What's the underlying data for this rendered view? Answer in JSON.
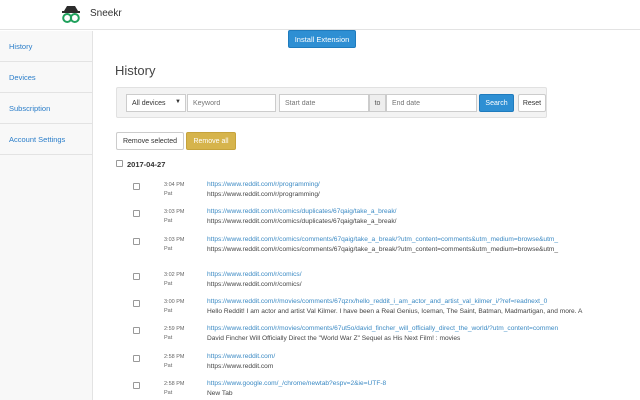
{
  "app": {
    "brand": "Sneekr"
  },
  "header": {
    "install_label": "Install Extension"
  },
  "sidebar": {
    "items": [
      {
        "label": "History"
      },
      {
        "label": "Devices"
      },
      {
        "label": "Subscription"
      },
      {
        "label": "Account Settings"
      }
    ]
  },
  "main": {
    "title": "History",
    "filters": {
      "device_selected": "All devices",
      "keyword_placeholder": "Keyword",
      "start_placeholder": "Start date",
      "to_label": "to",
      "end_placeholder": "End date",
      "search_label": "Search",
      "reset_label": "Reset"
    },
    "actions": {
      "remove_selected_label": "Remove selected",
      "remove_all_label": "Remove all"
    },
    "date_group": "2017-04-27",
    "entries": [
      {
        "time": "3:04 PM",
        "device": "Pat",
        "url": "https://www.reddit.com/r/programming/",
        "title": "https://www.reddit.com/r/programming/"
      },
      {
        "time": "3:03 PM",
        "device": "Pat",
        "url": "https://www.reddit.com/r/comics/duplicates/67qaig/take_a_break/",
        "title": "https://www.reddit.com/r/comics/duplicates/67qaig/take_a_break/"
      },
      {
        "time": "3:03 PM",
        "device": "Pat",
        "url": "https://www.reddit.com/r/comics/comments/67qaig/take_a_break/?utm_content=comments&utm_medium=browse&utm_",
        "title": "https://www.reddit.com/r/comics/comments/67qaig/take_a_break/?utm_content=comments&utm_medium=browse&utm_"
      },
      {
        "time": "3:02 PM",
        "device": "Pat",
        "url": "https://www.reddit.com/r/comics/",
        "title": "https://www.reddit.com/r/comics/"
      },
      {
        "time": "3:00 PM",
        "device": "Pat",
        "url": "https://www.reddit.com/r/movies/comments/67qzrx/hello_reddit_i_am_actor_and_artist_val_kilmer_i/?ref=readnext_0",
        "title": "Hello Reddit! I am actor and artist Val Kilmer. I have been a Real Genius, Iceman, The Saint, Batman, Madmartigan, and more. A"
      },
      {
        "time": "2:59 PM",
        "device": "Pat",
        "url": "https://www.reddit.com/r/movies/comments/67ut5o/david_fincher_will_officially_direct_the_world/?utm_content=commen",
        "title": "David Fincher Will Officially Direct the \"World War Z\" Sequel as His Next Film! : movies"
      },
      {
        "time": "2:58 PM",
        "device": "Pat",
        "url": "https://www.reddit.com/",
        "title": "https://www.reddit.com"
      },
      {
        "time": "2:58 PM",
        "device": "Pat",
        "url": "https://www.google.com/_/chrome/newtab?espv=2&ie=UTF-8",
        "title": "New Tab"
      }
    ]
  }
}
